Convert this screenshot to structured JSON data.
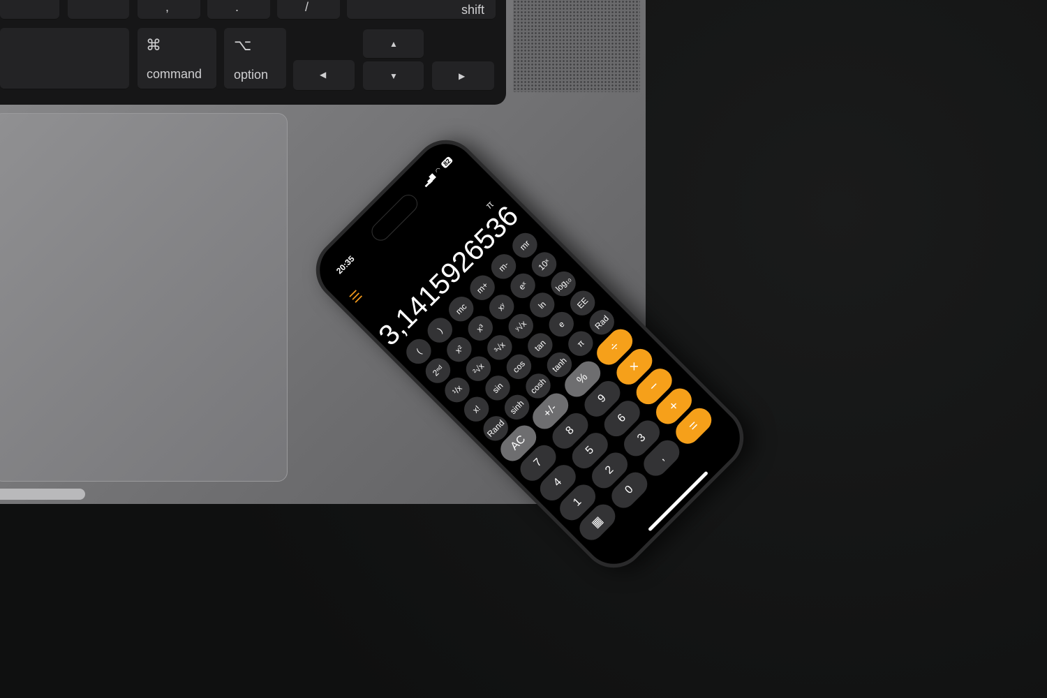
{
  "keyboard": {
    "row_top": [
      "",
      "",
      ",",
      ".",
      "/",
      "shift"
    ],
    "command": {
      "symbol": "⌘",
      "label": "command"
    },
    "option": {
      "symbol": "⌥",
      "label": "option"
    },
    "arrows": {
      "up": "▲",
      "down": "▼",
      "left": "◀",
      "right": "▶"
    }
  },
  "phone": {
    "status": {
      "time": "20:35",
      "battery": "82",
      "signal_icon": "cellular-signal",
      "wifi_icon": "wifi"
    },
    "menu_icon": "list-icon",
    "mode_label": "π",
    "display": "3,1415926536",
    "scientific_keys": [
      [
        "(",
        ")",
        "mc",
        "m+",
        "m-",
        "mr"
      ],
      [
        "2ⁿᵈ",
        "x²",
        "x³",
        "xʸ",
        "eˣ",
        "10ˣ"
      ],
      [
        "¹/x",
        "²√x",
        "³√x",
        "ʸ√x",
        "ln",
        "log₁₀"
      ],
      [
        "x!",
        "sin",
        "cos",
        "tan",
        "e",
        "EE"
      ],
      [
        "Rand",
        "sinh",
        "cosh",
        "tanh",
        "π",
        "Rad"
      ]
    ],
    "basic_keys": [
      [
        "AC",
        "+/-",
        "%",
        "÷"
      ],
      [
        "7",
        "8",
        "9",
        "×"
      ],
      [
        "4",
        "5",
        "6",
        "−"
      ],
      [
        "1",
        "2",
        "3",
        "+"
      ],
      [
        "▦",
        "0",
        ",",
        "="
      ]
    ],
    "colors": {
      "operator": "#f6a01a",
      "function": "#6e6e70",
      "key": "#333335"
    }
  }
}
